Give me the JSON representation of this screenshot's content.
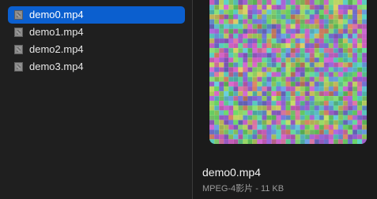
{
  "files": [
    {
      "name": "demo0.mp4",
      "selected": true
    },
    {
      "name": "demo1.mp4",
      "selected": false
    },
    {
      "name": "demo2.mp4",
      "selected": false
    },
    {
      "name": "demo3.mp4",
      "selected": false
    }
  ],
  "preview": {
    "title": "demo0.mp4",
    "meta": "MPEG-4影片 - 11 KB"
  },
  "colors": {
    "selection": "#0b5fcf"
  }
}
